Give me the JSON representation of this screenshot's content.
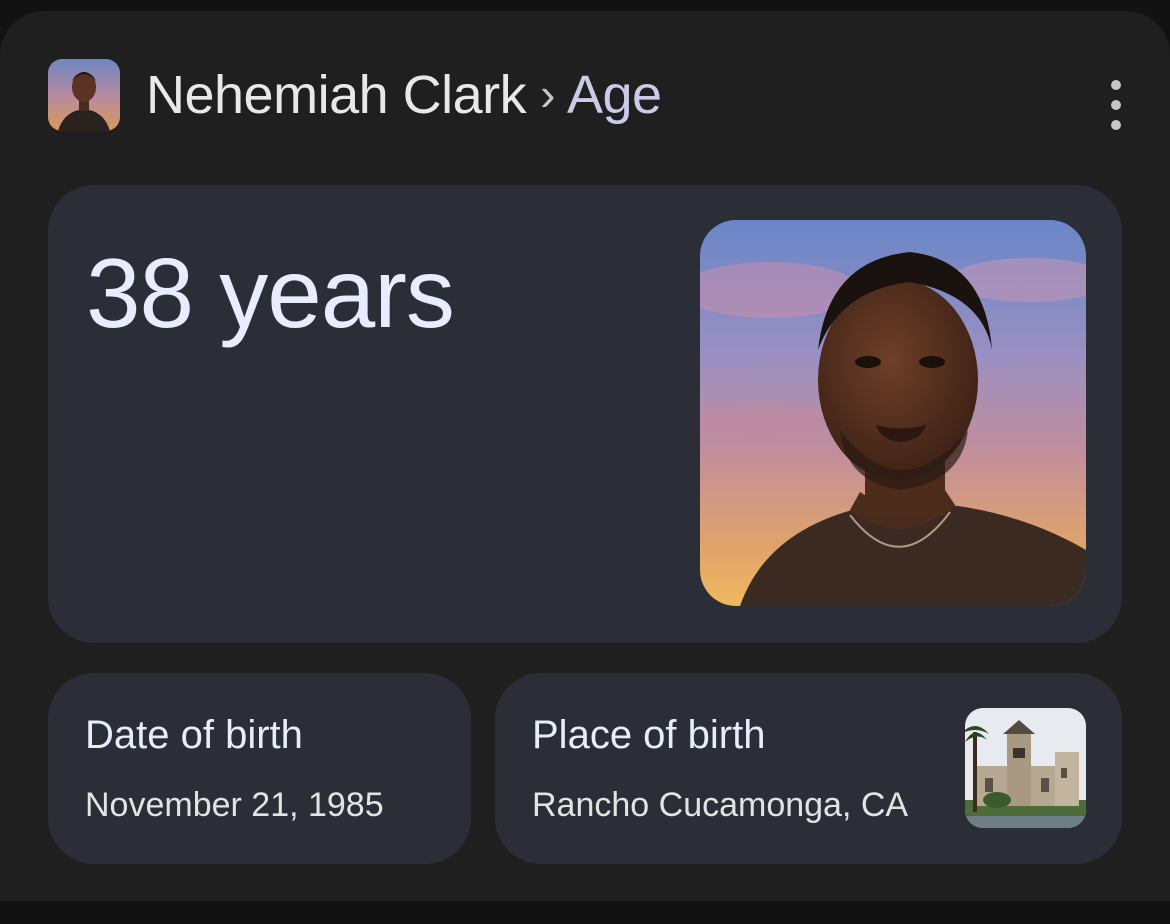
{
  "header": {
    "entity_name": "Nehemiah Clark",
    "separator": "›",
    "attribute": "Age",
    "more_icon": "more-vert-icon"
  },
  "answer": {
    "age_text": "38 years"
  },
  "facts": [
    {
      "label": "Date of birth",
      "value": "November 21, 1985"
    },
    {
      "label": "Place of birth",
      "value": "Rancho Cucamonga, CA"
    }
  ],
  "colors": {
    "page_bg": "#121212",
    "card_bg": "#1f1f1f",
    "panel_bg": "#2b2e36",
    "primary_text": "#e8ecff",
    "accent_text": "#c9cbe8"
  }
}
